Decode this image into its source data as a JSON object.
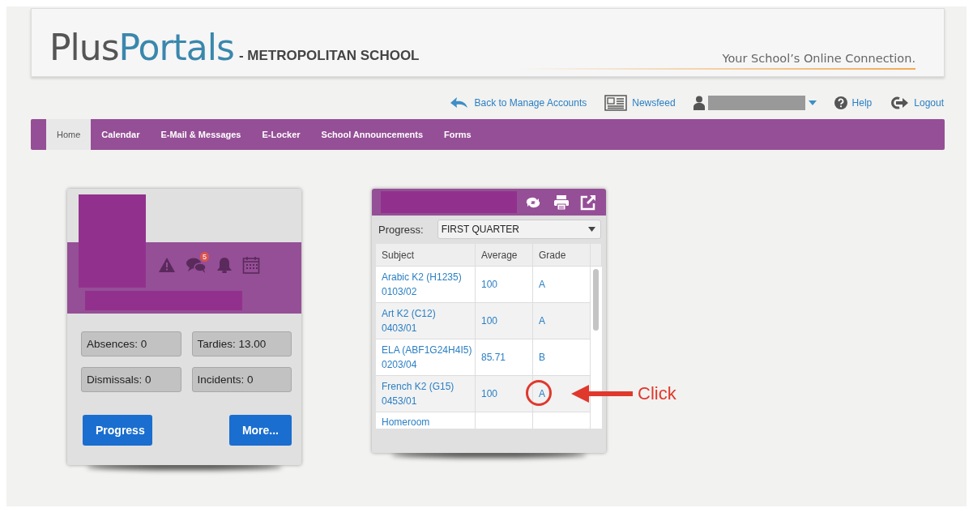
{
  "header": {
    "logo_plus": "Plus",
    "logo_portals": "Portals",
    "school": "- METROPOLITAN SCHOOL",
    "tagline": "Your School’s Online Connection."
  },
  "top_links": [
    {
      "kind": "back",
      "label": "Back to Manage Accounts"
    },
    {
      "kind": "news",
      "label": "Newsfeed"
    },
    {
      "kind": "user"
    },
    {
      "kind": "help",
      "label": "Help"
    },
    {
      "kind": "logout",
      "label": "Logout"
    }
  ],
  "nav": [
    {
      "label": "Home",
      "selected": true
    },
    {
      "label": "Calendar",
      "selected": false
    },
    {
      "label": "E-Mail & Messages",
      "selected": false
    },
    {
      "label": "E-Locker",
      "selected": false
    },
    {
      "label": "School Announcements",
      "selected": false
    },
    {
      "label": "Forms",
      "selected": false
    }
  ],
  "student_card": {
    "alerts": [
      {
        "kind": "warning"
      },
      {
        "kind": "messages",
        "badge": "5"
      },
      {
        "kind": "bell"
      },
      {
        "kind": "calendar"
      }
    ],
    "stats": [
      "Absences: 0",
      "Tardies: 13.00",
      "Dismissals: 0",
      "Incidents: 0"
    ],
    "buttons": [
      "Progress",
      "More..."
    ]
  },
  "progress_card": {
    "label": "Progress:",
    "period": "FIRST QUARTER",
    "columns": [
      "Subject",
      "Average",
      "Grade"
    ],
    "rows": [
      {
        "subject": "Arabic K2 (H1235)",
        "code": "0103/02",
        "average": "100",
        "grade": "A",
        "circled": false
      },
      {
        "subject": "Art K2 (C12)",
        "code": "0403/01",
        "average": "100",
        "grade": "A",
        "circled": false
      },
      {
        "subject": "ELA (ABF1G24H4I5)",
        "code": "0203/04",
        "average": "85.71",
        "grade": "B",
        "circled": false
      },
      {
        "subject": "French K2 (G15)",
        "code": "0453/01",
        "average": "100",
        "grade": "A",
        "circled": true
      },
      {
        "subject": "Homeroom",
        "circled": false
      }
    ]
  },
  "annotation": {
    "text": "Click"
  }
}
